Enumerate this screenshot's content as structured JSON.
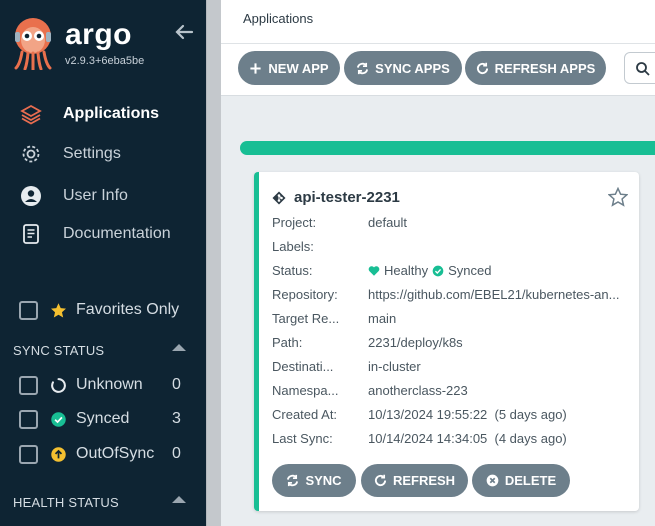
{
  "sidebar": {
    "brand": "argo",
    "version": "v2.9.3+6eba5be",
    "nav": [
      {
        "label": "Applications",
        "icon": "layers-icon"
      },
      {
        "label": "Settings",
        "icon": "gear-icon"
      },
      {
        "label": "User Info",
        "icon": "user-circle-icon"
      },
      {
        "label": "Documentation",
        "icon": "book-icon"
      }
    ],
    "favorites_label": "Favorites Only",
    "sync_status_title": "SYNC STATUS",
    "sync_status": [
      {
        "label": "Unknown",
        "count": "0",
        "icon": "circle-notch-icon"
      },
      {
        "label": "Synced",
        "count": "3",
        "icon": "check-circle-icon"
      },
      {
        "label": "OutOfSync",
        "count": "0",
        "icon": "arrow-up-circle-icon"
      }
    ],
    "health_status_title": "HEALTH STATUS"
  },
  "main": {
    "breadcrumb": "Applications",
    "toolbar": {
      "new_app": "NEW APP",
      "sync_apps": "SYNC APPS",
      "refresh_apps": "REFRESH APPS"
    },
    "card": {
      "name": "api-tester-2231",
      "fields": [
        {
          "key": "Project:",
          "value": "default"
        },
        {
          "key": "Labels:",
          "value": ""
        },
        {
          "key": "Status:",
          "health": "Healthy",
          "sync": "Synced"
        },
        {
          "key": "Repository:",
          "value": "https://github.com/EBEL21/kubernetes-an..."
        },
        {
          "key": "Target Re...",
          "value": "main"
        },
        {
          "key": "Path:",
          "value": "2231/deploy/k8s"
        },
        {
          "key": "Destinati...",
          "value": "in-cluster"
        },
        {
          "key": "Namespa...",
          "value": "anotherclass-223"
        },
        {
          "key": "Created At:",
          "value": "10/13/2024 19:55:22  (5 days ago)"
        },
        {
          "key": "Last Sync:",
          "value": "10/14/2024 14:34:05  (4 days ago)"
        }
      ],
      "buttons": {
        "sync": "SYNC",
        "refresh": "REFRESH",
        "delete": "DELETE"
      }
    }
  },
  "colors": {
    "sidebar_bg": "#0e2433",
    "accent_green": "#18be94",
    "button_gray": "#6d7f8b",
    "outofsync_yellow": "#f4c030",
    "layers_orange": "#e96d50"
  }
}
